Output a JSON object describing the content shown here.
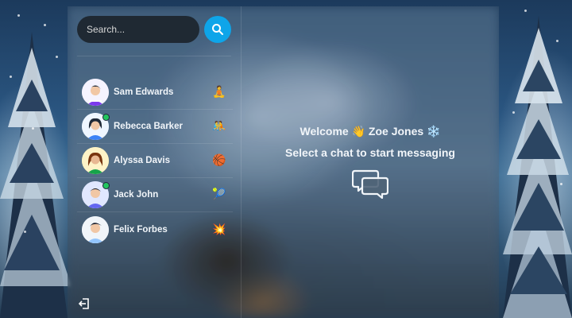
{
  "search": {
    "placeholder": "Search...",
    "button_icon": "search-icon"
  },
  "contacts": [
    {
      "name": "Sam Edwards",
      "emoji": "🧘",
      "online": false,
      "avatar_color": "#e9d5ff"
    },
    {
      "name": "Rebecca Barker",
      "emoji": "🤼",
      "online": true,
      "avatar_color": "#bfdbfe"
    },
    {
      "name": "Alyssa Davis",
      "emoji": "🏀",
      "online": false,
      "avatar_color": "#fde68a"
    },
    {
      "name": "Jack John",
      "emoji": "🎾",
      "online": true,
      "avatar_color": "#c7d2fe"
    },
    {
      "name": "Felix Forbes",
      "emoji": "💥",
      "online": false,
      "avatar_color": "#e0e7ff"
    }
  ],
  "sidebar": {
    "logout_icon": "logout-icon"
  },
  "main": {
    "welcome_prefix": "Welcome",
    "wave_emoji": "👋",
    "user_name": "Zoe Jones",
    "user_emoji": "❄️",
    "subtitle": "Select a chat to start messaging",
    "empty_icon": "chat-bubbles-icon"
  },
  "colors": {
    "accent": "#0ea5e9",
    "online": "#22c55e",
    "search_bg": "#1f2933"
  }
}
